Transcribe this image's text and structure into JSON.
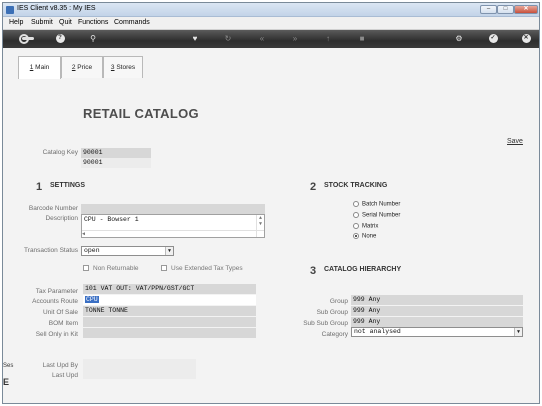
{
  "window": {
    "title": "IES Client v8.35 : My IES",
    "min": "–",
    "max": "□",
    "close": "✕"
  },
  "menu": [
    "Help",
    "Submit",
    "Quit",
    "Functions",
    "Commands"
  ],
  "toolbar_icons": [
    "key-icon",
    "help-icon",
    "search-icon",
    "heart-icon",
    "refresh-icon",
    "rewind-icon",
    "forward-icon",
    "upload-icon",
    "stop-icon",
    "settings-icon",
    "check-icon",
    "close-icon"
  ],
  "tabs": [
    {
      "num": "1",
      "label": " Main"
    },
    {
      "num": "2",
      "label": " Price"
    },
    {
      "num": "3",
      "label": " Stores"
    }
  ],
  "page_title": "RETAIL CATALOG",
  "save_label": "Save",
  "catalog_key": {
    "label": "Catalog Key",
    "value": "90001",
    "value2": "90001"
  },
  "settings": {
    "num": "1",
    "title": "SETTINGS",
    "barcode_label": "Barcode Number",
    "barcode_value": "",
    "description_label": "Description",
    "description_value": "CPU - Bowser 1",
    "transaction_status_label": "Transaction Status",
    "transaction_status_value": "open",
    "non_returnable_label": "Non Returnable",
    "extended_tax_label": "Use Extended Tax Types",
    "tax_parameter_label": "Tax Parameter",
    "tax_parameter_value": "101 VAT OUT: VAT/PPN/GST/GCT",
    "accounts_route_label": "Accounts Route",
    "accounts_route_value": "CPU",
    "unit_of_sale_label": "Unit Of Sale",
    "unit_of_sale_value": "TONNE TONNE",
    "bom_item_label": "BOM Item",
    "bom_item_value": "",
    "sell_only_in_kit_label": "Sell Only in Kit",
    "sell_only_in_kit_value": "",
    "last_upd_by_label": "Last Upd By",
    "last_upd_label": "Last Upd"
  },
  "stock_tracking": {
    "num": "2",
    "title": "STOCK TRACKING",
    "options": [
      "Batch Number",
      "Serial Number",
      "Matrix",
      "None"
    ],
    "selected": "None"
  },
  "catalog_hierarchy": {
    "num": "3",
    "title": "CATALOG HIERARCHY",
    "group_label": "Group",
    "group_value": "999 Any",
    "sub_group_label": "Sub Group",
    "sub_group_value": "999 Any",
    "sub_sub_group_label": "Sub Sub Group",
    "sub_sub_group_value": "999 Any",
    "category_label": "Category",
    "category_value": "not analysed"
  },
  "ghost_text": {
    "top": "Ses",
    "bottom": "E"
  }
}
